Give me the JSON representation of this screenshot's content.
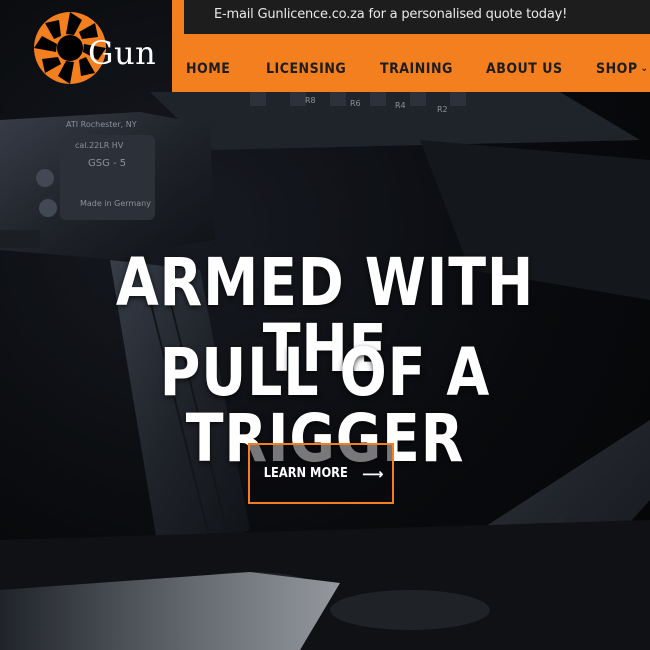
{
  "announcement": "E-mail Gunlicence.co.za for a personalised quote today!",
  "logo": {
    "text": "Gun",
    "icon": "camera-aperture-icon"
  },
  "nav": {
    "items": [
      {
        "label": "HOME"
      },
      {
        "label": "LICENSING"
      },
      {
        "label": "TRAINING"
      },
      {
        "label": "ABOUT US"
      },
      {
        "label": "SHOP"
      }
    ]
  },
  "hero": {
    "line1": "ARMED WITH THE",
    "line2": "PULL OF A TRIGGER",
    "cta_label": "LEARN MORE",
    "cta_icon": "arrow-right-icon",
    "background_engravings": {
      "maker": "ATI Rochester, NY",
      "caliber": "cal.22LR HV",
      "model": "GSG - 5",
      "origin": "Made in Germany",
      "rail_marks": [
        "R8",
        "R6",
        "R4",
        "R2"
      ]
    }
  },
  "colors": {
    "accent": "#f47f1e",
    "notice_bg": "#1d1d1d",
    "text_light": "#ffffff"
  }
}
